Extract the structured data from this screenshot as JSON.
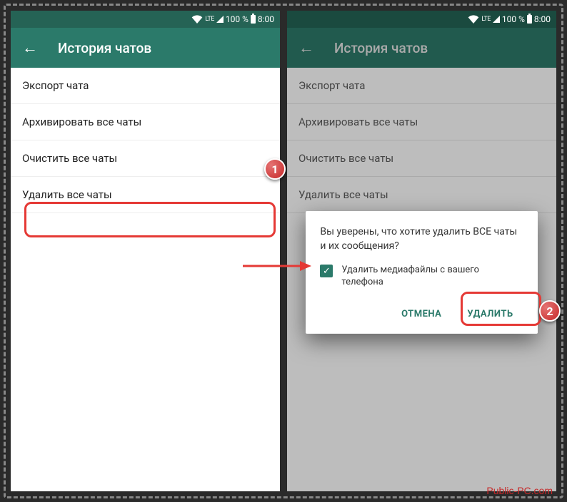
{
  "status": {
    "lte": "LTE",
    "battery_pct": "100 %",
    "time": "8:00"
  },
  "app_bar": {
    "title": "История чатов"
  },
  "menu": {
    "export": "Экспорт чата",
    "archive": "Архивировать все чаты",
    "clear": "Очистить все чаты",
    "delete": "Удалить все чаты"
  },
  "dialog": {
    "message": "Вы уверены, что хотите удалить ВСЕ чаты и их сообщения?",
    "checkbox_label": "Удалить медиафайлы с вашего телефона",
    "cancel": "ОТМЕНА",
    "confirm": "УДАЛИТЬ"
  },
  "badges": {
    "b1": "1",
    "b2": "2"
  },
  "watermark": "Public-PC.com"
}
